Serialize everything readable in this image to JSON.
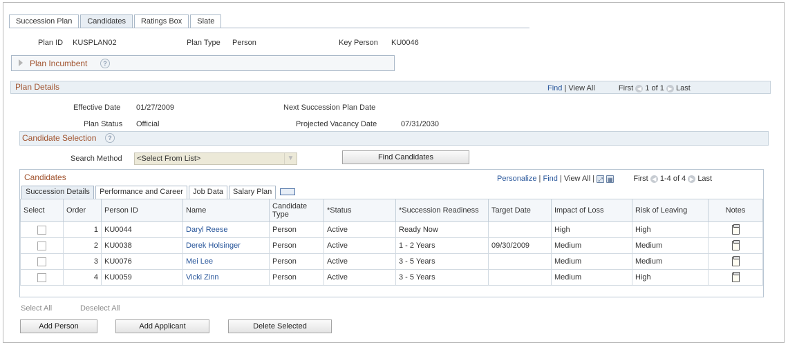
{
  "tabs": [
    "Succession Plan",
    "Candidates",
    "Ratings Box",
    "Slate"
  ],
  "header": {
    "plan_id_label": "Plan ID",
    "plan_id": "KUSPLAN02",
    "plan_type_label": "Plan Type",
    "plan_type": "Person",
    "key_person_label": "Key Person",
    "key_person": "KU0046"
  },
  "plan_incumbent_label": "Plan Incumbent",
  "plan_details": {
    "title": "Plan Details",
    "nav": {
      "find": "Find",
      "view_all": "View All",
      "first": "First",
      "range": "1 of 1",
      "last": "Last"
    },
    "effective_date_label": "Effective Date",
    "effective_date": "01/27/2009",
    "plan_status_label": "Plan Status",
    "plan_status": "Official",
    "next_plan_date_label": "Next Succession Plan Date",
    "next_plan_date": "",
    "projected_vacancy_label": "Projected Vacancy Date",
    "projected_vacancy": "07/31/2030"
  },
  "candidate_selection": {
    "title": "Candidate Selection",
    "search_method_label": "Search Method",
    "search_method_value": "<Select From List>",
    "find_button": "Find Candidates"
  },
  "candidates": {
    "title": "Candidates",
    "nav": {
      "personalize": "Personalize",
      "find": "Find",
      "view_all": "View All",
      "first": "First",
      "range": "1-4 of 4",
      "last": "Last"
    },
    "subtabs": [
      "Succession Details",
      "Performance and Career",
      "Job Data",
      "Salary Plan"
    ],
    "columns": [
      "Select",
      "Order",
      "Person ID",
      "Name",
      "Candidate Type",
      "*Status",
      "*Succession Readiness",
      "Target Date",
      "Impact of Loss",
      "Risk of Leaving",
      "Notes"
    ],
    "rows": [
      {
        "order": "1",
        "person_id": "KU0044",
        "name": "Daryl Reese",
        "type": "Person",
        "status": "Active",
        "readiness": "Ready Now",
        "target_date": "",
        "impact": "High",
        "risk": "High"
      },
      {
        "order": "2",
        "person_id": "KU0038",
        "name": "Derek Holsinger",
        "type": "Person",
        "status": "Active",
        "readiness": "1 - 2 Years",
        "target_date": "09/30/2009",
        "impact": "Medium",
        "risk": "Medium"
      },
      {
        "order": "3",
        "person_id": "KU0076",
        "name": "Mei Lee",
        "type": "Person",
        "status": "Active",
        "readiness": "3 - 5 Years",
        "target_date": "",
        "impact": "Medium",
        "risk": "Medium"
      },
      {
        "order": "4",
        "person_id": "KU0059",
        "name": "Vicki Zinn",
        "type": "Person",
        "status": "Active",
        "readiness": "3 - 5 Years",
        "target_date": "",
        "impact": "Medium",
        "risk": "High"
      }
    ],
    "select_all": "Select All",
    "deselect_all": "Deselect All"
  },
  "buttons": {
    "add_person": "Add Person",
    "add_applicant": "Add Applicant",
    "delete_selected": "Delete Selected"
  }
}
